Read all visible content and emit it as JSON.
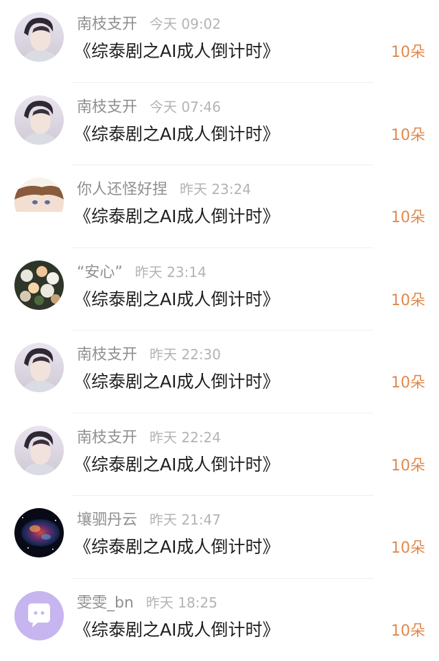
{
  "colors": {
    "name": "#8f8f8f",
    "time": "#b3b3b3",
    "title": "#1e1e1e",
    "gift": "#e0884e",
    "divider": "#efefef"
  },
  "items": [
    {
      "user": "南枝支开",
      "time": "今天 09:02",
      "title": "《综泰剧之AI成人倒计时》",
      "gift": "10朵",
      "avatar": "portrait-avatar"
    },
    {
      "user": "南枝支开",
      "time": "今天 07:46",
      "title": "《综泰剧之AI成人倒计时》",
      "gift": "10朵",
      "avatar": "portrait-avatar"
    },
    {
      "user": "你人还怪好捏",
      "time": "昨天 23:24",
      "title": "《综泰剧之AI成人倒计时》",
      "gift": "10朵",
      "avatar": "anime-avatar"
    },
    {
      "user": "“安心”",
      "time": "昨天 23:14",
      "title": "《综泰剧之AI成人倒计时》",
      "gift": "10朵",
      "avatar": "flowers-avatar"
    },
    {
      "user": "南枝支开",
      "time": "昨天 22:30",
      "title": "《综泰剧之AI成人倒计时》",
      "gift": "10朵",
      "avatar": "portrait-avatar"
    },
    {
      "user": "南枝支开",
      "time": "昨天 22:24",
      "title": "《综泰剧之AI成人倒计时》",
      "gift": "10朵",
      "avatar": "portrait-avatar"
    },
    {
      "user": "壤驷丹云",
      "time": "昨天 21:47",
      "title": "《综泰剧之AI成人倒计时》",
      "gift": "10朵",
      "avatar": "nebula-avatar"
    },
    {
      "user": "雯雯_bn",
      "time": "昨天 18:25",
      "title": "《综泰剧之AI成人倒计时》",
      "gift": "10朵",
      "avatar": "default-chat-avatar"
    }
  ]
}
